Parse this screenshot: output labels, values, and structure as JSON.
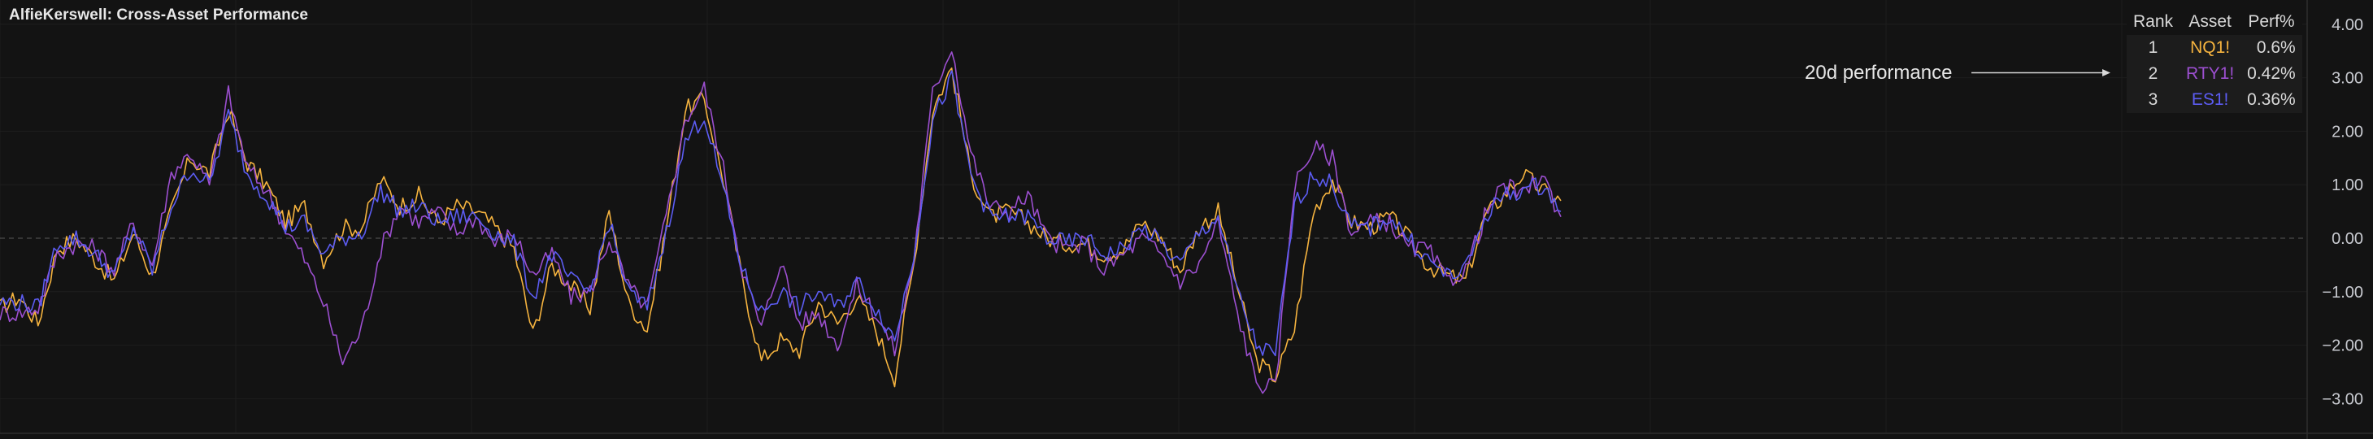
{
  "title": "AlfieKerswell: Cross-Asset Performance",
  "annotation": "20d performance",
  "table": {
    "headers": [
      "Rank",
      "Asset",
      "Perf%"
    ],
    "rows": [
      {
        "rank": "1",
        "asset": "NQ1!",
        "perf": "0.6%",
        "color": "#f5b33f"
      },
      {
        "rank": "2",
        "asset": "RTY1!",
        "perf": "0.42%",
        "color": "#9c4fd0"
      },
      {
        "rank": "3",
        "asset": "ES1!",
        "perf": "0.36%",
        "color": "#5c5cf2"
      }
    ]
  },
  "chart_data": {
    "type": "line",
    "ylim": [
      -3.8,
      4.2
    ],
    "ticks": [
      4,
      3,
      2,
      1,
      0,
      -1,
      -2,
      -3
    ],
    "tick_labels": [
      "4.00",
      "3.00",
      "2.00",
      "1.00",
      "0.00",
      "−1.00",
      "−2.00",
      "−3.00"
    ],
    "zero_line": true,
    "grid": true,
    "x": [
      0,
      10,
      20,
      30,
      40,
      50,
      60,
      70,
      80,
      90,
      100,
      110,
      120,
      130,
      140,
      150,
      160,
      170,
      180,
      190,
      200,
      210,
      220,
      230,
      240,
      250,
      260,
      270,
      280,
      290,
      300,
      310,
      320,
      330,
      340,
      350,
      360,
      370,
      380,
      390,
      400,
      410,
      420,
      430,
      440,
      450,
      460,
      470,
      480,
      490,
      500,
      510,
      520,
      530,
      540,
      550,
      560,
      570,
      580,
      590,
      600
    ],
    "series": [
      {
        "name": "NQ1!",
        "color": "#f5b33f",
        "values": [
          -1.3,
          -1.1,
          -1.6,
          -0.2,
          0.0,
          -0.4,
          -0.8,
          0.1,
          -0.7,
          0.5,
          1.5,
          1.2,
          2.4,
          1.4,
          1.0,
          0.3,
          0.6,
          -0.4,
          0.2,
          0.2,
          1.1,
          0.6,
          0.8,
          0.3,
          0.6,
          0.5,
          0.2,
          -0.2,
          -1.8,
          -0.5,
          -0.9,
          -1.3,
          0.5,
          -1.2,
          -1.7,
          0.2,
          2.4,
          2.6,
          1.1,
          -0.8,
          -2.3,
          -1.9,
          -2.1,
          -1.2,
          -1.6,
          -1.1,
          -1.7,
          -2.6,
          -0.5,
          2.4,
          3.2,
          1.2,
          0.4,
          0.5,
          0.3,
          0.0,
          -0.1,
          -0.1,
          -0.3,
          -0.2,
          0.3,
          0.0,
          -0.6,
          0.2,
          0.5,
          -0.9,
          -2.3,
          -2.6,
          -1.7,
          0.5,
          1.1,
          0.3,
          0.2,
          0.4,
          0.0,
          -0.5,
          -0.7,
          -0.8,
          0.4,
          0.8,
          1.2,
          0.9,
          0.7
        ]
      },
      {
        "name": "RTY1!",
        "color": "#9c4fd0",
        "values": [
          -1.4,
          -1.4,
          -1.3,
          -0.3,
          -0.1,
          -0.2,
          -0.6,
          0.3,
          -0.5,
          1.2,
          1.6,
          1.0,
          2.7,
          1.3,
          0.9,
          0.2,
          -0.4,
          -1.2,
          -2.3,
          -1.7,
          -0.2,
          0.6,
          0.3,
          0.5,
          0.1,
          0.4,
          -0.1,
          0.1,
          -0.7,
          -0.3,
          -1.1,
          -1.0,
          0.0,
          -0.9,
          -1.3,
          0.4,
          2.2,
          2.8,
          1.3,
          -0.6,
          -1.7,
          -0.4,
          -1.6,
          -1.4,
          -2.0,
          -0.9,
          -1.4,
          -2.1,
          -0.4,
          2.7,
          3.6,
          1.6,
          0.6,
          0.5,
          0.8,
          0.0,
          -0.2,
          -0.1,
          -0.6,
          -0.3,
          0.0,
          -0.3,
          -0.8,
          -0.5,
          0.3,
          -1.4,
          -2.7,
          -2.8,
          1.0,
          1.7,
          1.5,
          0.1,
          0.3,
          0.3,
          -0.2,
          -0.2,
          -0.8,
          -0.6,
          0.4,
          1.0,
          0.8,
          1.2,
          0.4
        ]
      },
      {
        "name": "ES1!",
        "color": "#5c5cf2",
        "values": [
          -1.2,
          -1.2,
          -1.3,
          -0.1,
          0.0,
          -0.3,
          -0.7,
          0.2,
          -0.6,
          0.6,
          1.3,
          1.0,
          2.3,
          1.2,
          0.8,
          0.2,
          0.3,
          -0.3,
          0.0,
          0.1,
          0.9,
          0.5,
          0.6,
          0.3,
          0.4,
          0.4,
          0.1,
          -0.1,
          -1.1,
          -0.3,
          -0.8,
          -1.0,
          0.3,
          -1.0,
          -1.3,
          0.1,
          1.8,
          2.3,
          0.9,
          -0.6,
          -1.4,
          -1.0,
          -1.3,
          -1.0,
          -1.3,
          -0.8,
          -1.3,
          -1.9,
          -0.3,
          2.2,
          3.0,
          1.2,
          0.4,
          0.4,
          0.4,
          0.0,
          -0.1,
          0.0,
          -0.3,
          -0.2,
          0.2,
          -0.1,
          -0.5,
          0.1,
          0.4,
          -1.0,
          -2.0,
          -2.2,
          0.6,
          1.2,
          1.0,
          0.2,
          0.2,
          0.4,
          0.0,
          -0.4,
          -0.7,
          -0.6,
          0.4,
          0.8,
          0.9,
          1.0,
          0.5
        ]
      }
    ]
  }
}
